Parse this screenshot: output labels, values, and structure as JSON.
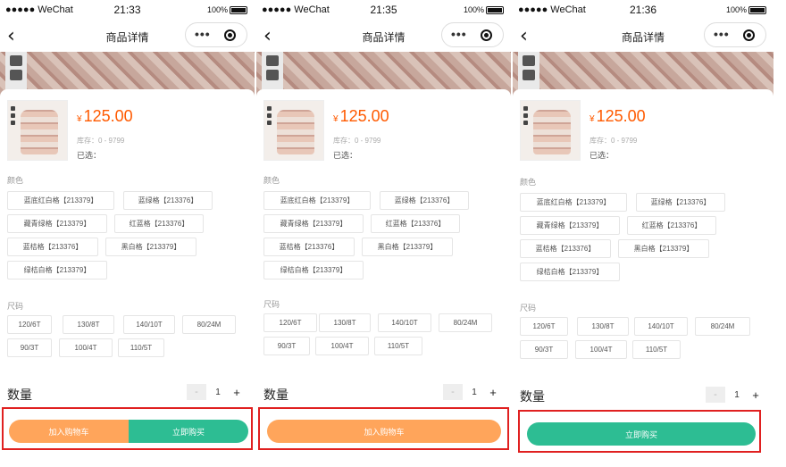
{
  "colors": {
    "accent_orange": "#ffa55b",
    "accent_green": "#2dbd93",
    "price": "#ff5a00",
    "highlight_border": "#e02020"
  },
  "screens": [
    {
      "status": {
        "carrier": "●●●●● WeChat",
        "time": "21:33",
        "battery": "100%"
      },
      "nav": {
        "back_icon": "‹",
        "title": "商品详情",
        "more_icon": "•••"
      },
      "product": {
        "currency": "¥",
        "price": "125.00",
        "stock": "库存：0 - 9799",
        "selected": "已选："
      },
      "color_label": "颜色",
      "colors": [
        "蓝底红白格【213379】",
        "蓝绿格【213376】",
        "藏青绿格【213379】",
        "红蓝格【213376】",
        "蓝桔格【213376】",
        "黑白格【213379】",
        "绿桔白格【213379】"
      ],
      "size_label": "尺码",
      "sizes": [
        "120/6T",
        "130/8T",
        "140/10T",
        "80/24M",
        "90/3T",
        "100/4T",
        "110/5T"
      ],
      "qty_label": "数量",
      "qty": {
        "minus": "-",
        "value": "1",
        "plus": "+"
      },
      "buttons": {
        "add_cart": "加入购物车",
        "buy_now": "立即购买"
      }
    },
    {
      "status": {
        "carrier": "●●●●● WeChat",
        "time": "21:35",
        "battery": "100%"
      },
      "nav": {
        "back_icon": "‹",
        "title": "商品详情",
        "more_icon": "•••"
      },
      "product": {
        "currency": "¥",
        "price": "125.00",
        "stock": "库存：0 - 9799",
        "selected": "已选："
      },
      "color_label": "颜色",
      "colors": [
        "蓝底红白格【213379】",
        "蓝绿格【213376】",
        "藏青绿格【213379】",
        "红蓝格【213376】",
        "蓝桔格【213376】",
        "黑白格【213379】",
        "绿桔白格【213379】"
      ],
      "size_label": "尺码",
      "sizes": [
        "120/6T",
        "130/8T",
        "140/10T",
        "80/24M",
        "90/3T",
        "100/4T",
        "110/5T"
      ],
      "qty_label": "数量",
      "qty": {
        "minus": "-",
        "value": "1",
        "plus": "+"
      },
      "buttons": {
        "add_cart": "加入购物车"
      }
    },
    {
      "status": {
        "carrier": "●●●●● WeChat",
        "time": "21:36",
        "battery": "100%"
      },
      "nav": {
        "back_icon": "‹",
        "title": "商品详情",
        "more_icon": "•••"
      },
      "product": {
        "currency": "¥",
        "price": "125.00",
        "stock": "库存：0 - 9799",
        "selected": "已选："
      },
      "color_label": "颜色",
      "colors": [
        "蓝底红白格【213379】",
        "蓝绿格【213376】",
        "藏青绿格【213379】",
        "红蓝格【213376】",
        "蓝桔格【213376】",
        "黑白格【213379】",
        "绿桔白格【213379】"
      ],
      "size_label": "尺码",
      "sizes": [
        "120/6T",
        "130/8T",
        "140/10T",
        "80/24M",
        "90/3T",
        "100/4T",
        "110/5T"
      ],
      "qty_label": "数量",
      "qty": {
        "minus": "-",
        "value": "1",
        "plus": "+"
      },
      "buttons": {
        "buy_now": "立即购买"
      }
    }
  ]
}
